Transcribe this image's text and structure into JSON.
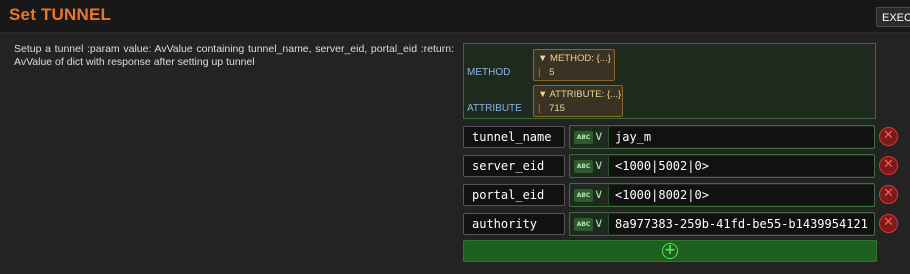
{
  "header": {
    "title": "Set TUNNEL",
    "exec_label": "EXEC"
  },
  "description": "Setup a tunnel :param value: AvValue containing tunnel_name, server_eid, portal_eid :return: AvValue of dict with response after setting up tunnel",
  "metadata": {
    "method_label": "METHOD",
    "attribute_label": "ATTRIBUTE",
    "method_obj": {
      "head": "METHOD: {...}",
      "value": "5"
    },
    "attribute_obj": {
      "head": "ATTRIBUTE: {...}",
      "value": "715"
    }
  },
  "params": [
    {
      "name": "tunnel_name",
      "type_badge": "ABC",
      "value": "jay_m"
    },
    {
      "name": "server_eid",
      "type_badge": "ABC",
      "value": "<1000|5002|0>"
    },
    {
      "name": "portal_eid",
      "type_badge": "ABC",
      "value": "<1000|8002|0>"
    },
    {
      "name": "authority",
      "type_badge": "ABC",
      "value": "8a977383-259b-41fd-be55-b1439954121"
    }
  ],
  "icons": {
    "expand": "triangle-down-icon",
    "type_dropdown": "chevron-down-icon",
    "delete": "close-circle-icon",
    "add": "plus-circle-icon"
  },
  "colors": {
    "title": "#e8762b",
    "delete": "#e03434",
    "add": "#4de84d",
    "label_blue": "#8fb4e8"
  }
}
